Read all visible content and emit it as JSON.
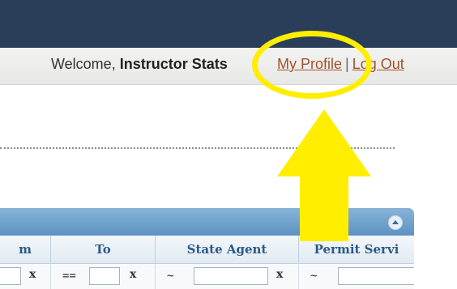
{
  "header": {
    "welcome_text": "Welcome,",
    "username": "Instructor Stats",
    "my_profile_label": "My Profile",
    "separator": "|",
    "logout_label": "Log Out"
  },
  "table": {
    "columns": [
      {
        "label": "m"
      },
      {
        "label": "To"
      },
      {
        "label": "State Agent"
      },
      {
        "label": "Permit Servi"
      }
    ],
    "filters": [
      {
        "operator": "",
        "clear": "x"
      },
      {
        "operator": "==",
        "clear": "x"
      },
      {
        "operator": "~",
        "clear": "x"
      },
      {
        "operator": "~",
        "clear": ""
      }
    ]
  },
  "annotation": {
    "highlight_color": "#ffee00",
    "arrow_direction": "up"
  },
  "colors": {
    "header_bg": "#2b3e59",
    "link": "#a0522d",
    "column_header_text": "#2d5a86"
  }
}
